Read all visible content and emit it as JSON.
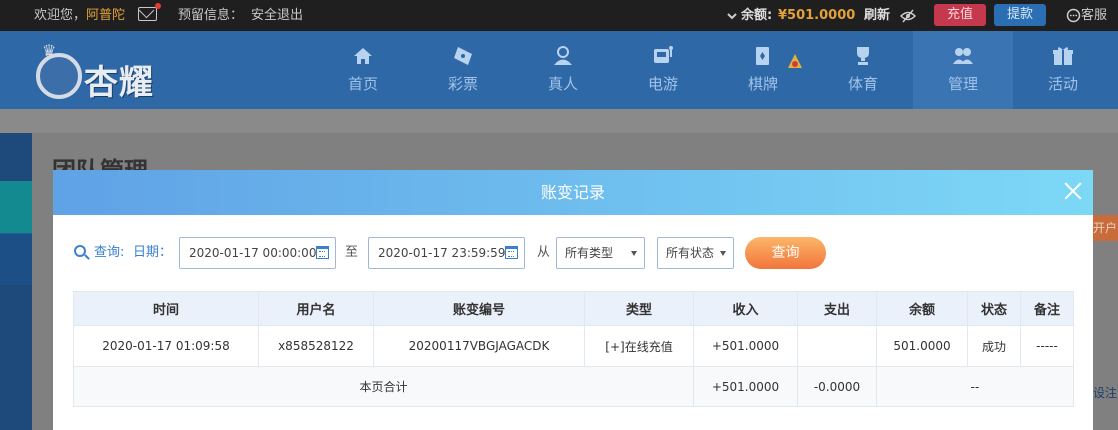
{
  "topbar": {
    "welcome": "欢迎您，",
    "username": "阿普陀",
    "reserved_info_label": "预留信息：",
    "logout": "安全退出",
    "balance_label": "余额:",
    "balance_amount": "¥501.0000",
    "refresh": "刷新",
    "charge": "充值",
    "withdraw": "提款",
    "service": "客服"
  },
  "header": {
    "logo_text": "杏耀",
    "nav": [
      {
        "label": "首页",
        "icon": "home-icon"
      },
      {
        "label": "彩票",
        "icon": "lottery-icon"
      },
      {
        "label": "真人",
        "icon": "live-dealer-icon"
      },
      {
        "label": "电游",
        "icon": "slot-machine-icon"
      },
      {
        "label": "棋牌",
        "icon": "card-game-icon"
      },
      {
        "label": "体育",
        "icon": "trophy-icon"
      },
      {
        "label": "管理",
        "icon": "users-icon"
      },
      {
        "label": "活动",
        "icon": "gift-icon"
      }
    ]
  },
  "page": {
    "title": "团队管理",
    "right_tab": "开户",
    "right_link": "设注记"
  },
  "modal": {
    "title": "账变记录",
    "filters": {
      "query_label": "查询:",
      "date_label": "日期：",
      "date_from": "2020-01-17 00:00:00",
      "to_label": "至",
      "date_to": "2020-01-17 23:59:59",
      "from_label": "从",
      "type_select": "所有类型",
      "status_select": "所有状态",
      "query_button": "查询"
    },
    "table": {
      "headers": [
        "时间",
        "用户名",
        "账变编号",
        "类型",
        "收入",
        "支出",
        "余额",
        "状态",
        "备注"
      ],
      "rows": [
        [
          "2020-01-17 01:09:58",
          "x858528122",
          "20200117VBGJAGACDK",
          "[+]在线充值",
          "+501.0000",
          "",
          "501.0000",
          "成功",
          "-----"
        ]
      ],
      "summary": {
        "label": "本页合计",
        "income": "+501.0000",
        "expense": "-0.0000",
        "rest": "--"
      }
    }
  },
  "colors": {
    "modal_header_start": "#5fa2e6",
    "modal_header_end": "#7dd8f6",
    "query_button": "#f2753b",
    "income_text": "#5b9a24",
    "accent": "#3a7fd0"
  }
}
